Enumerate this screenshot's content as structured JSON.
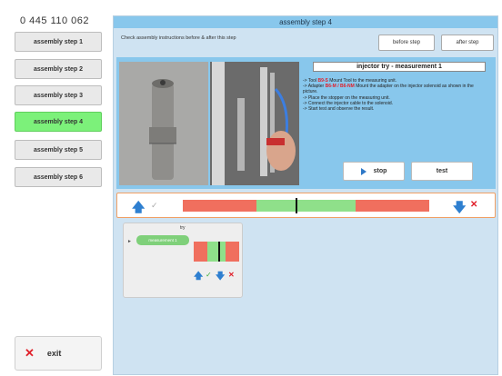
{
  "sidebar": {
    "part_number": "0 445 110 062",
    "steps": [
      {
        "label": "assembly step 1",
        "active": false
      },
      {
        "label": "assembly step 2",
        "active": false
      },
      {
        "label": "assembly step 3",
        "active": false
      },
      {
        "label": "assembly step 4",
        "active": true
      },
      {
        "label": "assembly step 5",
        "active": false
      },
      {
        "label": "assembly step 6",
        "active": false
      }
    ],
    "exit_label": "exit"
  },
  "main": {
    "title": "assembly step 4",
    "instruction": "Check assembly instructions before & after this step",
    "before_label": "before step",
    "after_label": "after step",
    "measurement_title": "injector  try - measurement  1",
    "steps": {
      "s1_prefix": "-> Tool ",
      "s1_code": "B9-S",
      "s1_suffix": " Mount Tool to the measuring unit.",
      "s2_prefix": "-> Adapter ",
      "s2_code": "B6-M / B6-NM",
      "s2_suffix": " Mount the adapter on the injector solenoid as shown in the picture.",
      "s3": "-> Place the stopper on the measuring unit.",
      "s4": "-> Connect the injector cable to the solenoid.",
      "s5": "-> Start test and observe the result."
    },
    "stop_label": "stop",
    "test_label": "test",
    "meter": {
      "segments": [
        {
          "color": "#f06f5e",
          "share": 0.3
        },
        {
          "color": "#8fe08a",
          "share": 0.4
        },
        {
          "color": "#f06f5e",
          "share": 0.3
        }
      ],
      "needle": 0.46
    },
    "card": {
      "title": "try",
      "chip_label": "measurement 1",
      "needle": 0.55
    }
  }
}
